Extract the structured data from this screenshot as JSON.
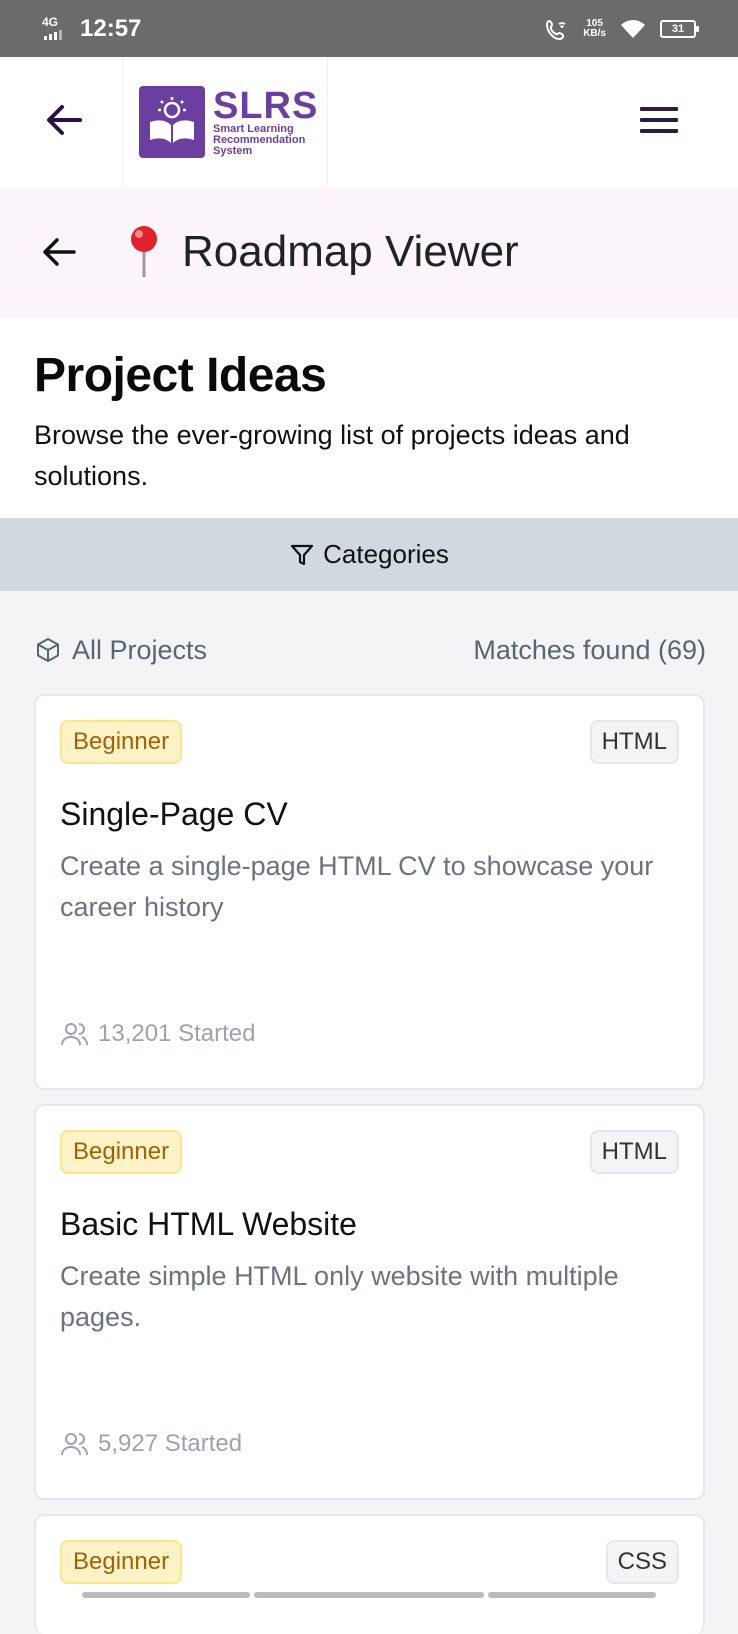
{
  "status_bar": {
    "network": "4G",
    "time": "12:57",
    "speed_value": "105",
    "speed_unit": "KB/s",
    "battery": "31"
  },
  "header": {
    "logo_title": "SLRS",
    "logo_sub_1": "Smart Learning",
    "logo_sub_2": "Recommendation",
    "logo_sub_3": "System",
    "brand_color": "#6b3fa0"
  },
  "roadmap": {
    "title": "Roadmap Viewer"
  },
  "intro": {
    "heading": "Project Ideas",
    "description": "Browse the ever-growing list of projects ideas and solutions."
  },
  "categories": {
    "label": "Categories"
  },
  "list": {
    "filter_label": "All Projects",
    "matches_label": "Matches found (69)"
  },
  "projects": [
    {
      "level": "Beginner",
      "tag": "HTML",
      "title": "Single-Page CV",
      "description": "Create a single-page HTML CV to showcase your career history",
      "started": "13,201 Started"
    },
    {
      "level": "Beginner",
      "tag": "HTML",
      "title": "Basic HTML Website",
      "description": "Create simple HTML only website with multiple pages.",
      "started": "5,927 Started"
    },
    {
      "level": "Beginner",
      "tag": "CSS"
    }
  ]
}
